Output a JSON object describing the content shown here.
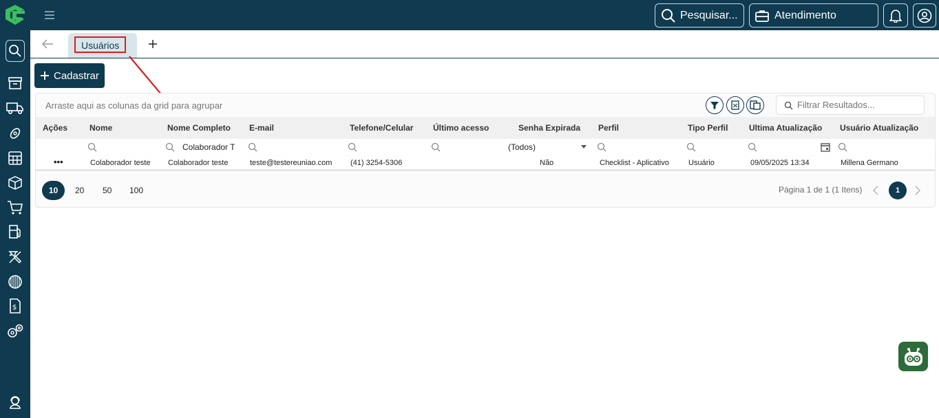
{
  "topbar": {
    "search_label": "Pesquisar...",
    "service_label": "Atendimento"
  },
  "tabs": [
    {
      "label": "Usuários",
      "active": true
    }
  ],
  "actions": {
    "register_label": "Cadastrar"
  },
  "grid": {
    "group_hint": "Arraste aqui as colunas da grid para agrupar",
    "search_placeholder": "Filtrar Resultados...",
    "columns": [
      "Ações",
      "Nome",
      "Nome Completo",
      "E-mail",
      "Telefone/Celular",
      "Último acesso",
      "Senha Expirada",
      "Perfil",
      "Tipo Perfil",
      "Ultima Atualização",
      "Usuário Atualização"
    ],
    "filters": {
      "nome_completo": "Colaborador T",
      "senha_expirada": "(Todos)"
    },
    "rows": [
      {
        "acoes": "•••",
        "nome": "Colaborador teste",
        "nome_completo": "Colaborador teste",
        "email": "teste@testereuniao.com",
        "telefone": "(41) 3254-5306",
        "ultimo_acesso": "",
        "senha_expirada": "Não",
        "perfil": "Checklist - Aplicativo",
        "tipo_perfil": "Usuário",
        "ultima_atualizacao": "09/05/2025 13:34",
        "usuario_atualizacao": "Millena Germano"
      }
    ],
    "page_sizes": [
      "10",
      "20",
      "50",
      "100"
    ],
    "active_page_size": "10",
    "page_info": "Página 1 de 1 (1 Itens)",
    "current_page": "1"
  },
  "colors": {
    "primary": "#0f3a4f",
    "highlight": "#e11b1b",
    "bot": "#2e6b3a",
    "logo": "#3bbf5c"
  }
}
